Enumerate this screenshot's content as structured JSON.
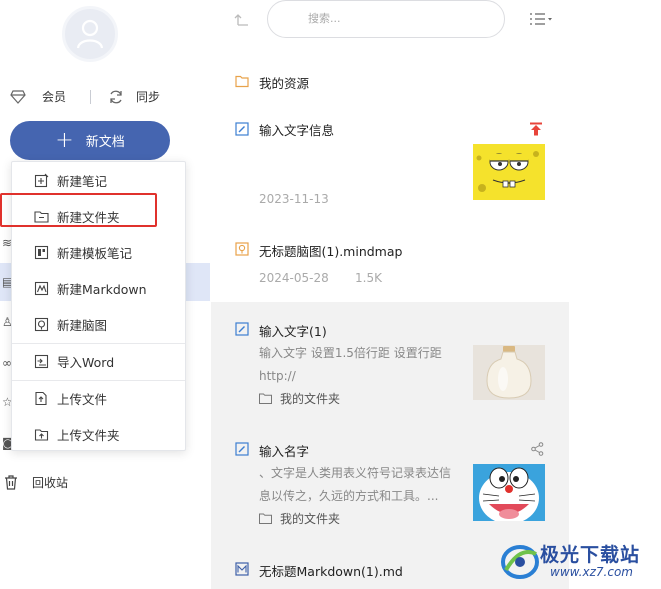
{
  "sidebar": {
    "member_label": "会员",
    "sync_label": "同步",
    "new_doc_label": "新文档",
    "trash_label": "回收站"
  },
  "menu": {
    "items": [
      {
        "label": "新建笔记",
        "icon": "new-note-icon"
      },
      {
        "label": "新建文件夹",
        "icon": "new-folder-icon"
      },
      {
        "label": "新建模板笔记",
        "icon": "template-note-icon"
      },
      {
        "label": "新建Markdown",
        "icon": "markdown-icon"
      },
      {
        "label": "新建脑图",
        "icon": "mindmap-icon"
      },
      {
        "label": "导入Word",
        "icon": "import-word-icon"
      },
      {
        "label": "上传文件",
        "icon": "upload-file-icon"
      },
      {
        "label": "上传文件夹",
        "icon": "upload-folder-icon"
      }
    ],
    "highlight_color": "#e0312c"
  },
  "toolbar": {
    "search_placeholder": "搜索..."
  },
  "list": {
    "entries": [
      {
        "title": "我的资源",
        "type": "folder"
      },
      {
        "title": "输入文字信息",
        "type": "note",
        "date": "2023-11-13",
        "pinned": true
      },
      {
        "title": "无标题脑图(1).mindmap",
        "type": "mindmap",
        "date": "2024-05-28",
        "size": "1.5K"
      },
      {
        "title": "输入文字(1)",
        "type": "note",
        "snippet": "输入文字 设置1.5倍行距 设置行距 http://",
        "folder": "我的文件夹"
      },
      {
        "title": "输入名字",
        "type": "note",
        "snippet": "、文字是人类用表义符号记录表达信息以传之，久远的方式和工具。...",
        "folder": "我的文件夹",
        "shared": true
      },
      {
        "title": "无标题Markdown(1).md",
        "type": "markdown"
      }
    ]
  },
  "watermark": {
    "cn": "极光下载站",
    "en": "www.xz7.com"
  },
  "colors": {
    "accent": "#4565b0",
    "selected_row": "#dfe6f7",
    "pin": "#e8443a"
  }
}
